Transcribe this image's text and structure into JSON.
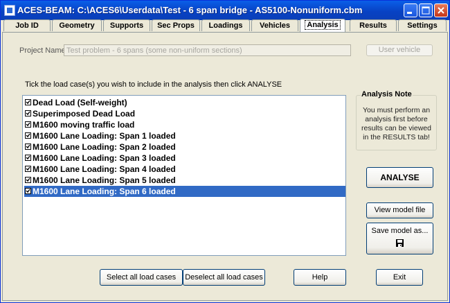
{
  "window": {
    "title": "ACES-BEAM:   C:\\ACES6\\Userdata\\Test - 6 span bridge - AS5100-Nonuniform.cbm",
    "controls": [
      "minimize-icon",
      "maximize-icon",
      "close-icon"
    ]
  },
  "tabs": [
    {
      "label": "Job ID",
      "active": false
    },
    {
      "label": "Geometry",
      "active": false
    },
    {
      "label": "Supports",
      "active": false
    },
    {
      "label": "Sec Props",
      "active": false
    },
    {
      "label": "Loadings",
      "active": false
    },
    {
      "label": "Vehicles",
      "active": false
    },
    {
      "label": "Analysis",
      "active": true
    },
    {
      "label": "Results",
      "active": false
    },
    {
      "label": "Settings",
      "active": false
    }
  ],
  "project": {
    "label": "Project Name:",
    "value": "Test problem - 6 spans (some non-uniform sections)",
    "user_vehicle_button": "User vehicle"
  },
  "instruction": "Tick the load case(s) you wish to include in the analysis then click ANALYSE",
  "load_cases": [
    {
      "label": "Dead Load (Self-weight)",
      "checked": true,
      "selected": false
    },
    {
      "label": "Superimposed Dead Load",
      "checked": true,
      "selected": false
    },
    {
      "label": "M1600 moving traffic load",
      "checked": true,
      "selected": false
    },
    {
      "label": "M1600 Lane Loading:  Span 1 loaded",
      "checked": true,
      "selected": false
    },
    {
      "label": "M1600 Lane Loading:  Span 2 loaded",
      "checked": true,
      "selected": false
    },
    {
      "label": "M1600 Lane Loading:  Span 3 loaded",
      "checked": true,
      "selected": false
    },
    {
      "label": "M1600 Lane Loading:  Span 4 loaded",
      "checked": true,
      "selected": false
    },
    {
      "label": "M1600 Lane Loading:  Span 5 loaded",
      "checked": true,
      "selected": false
    },
    {
      "label": "M1600 Lane Loading:  Span 6 loaded",
      "checked": true,
      "selected": true
    }
  ],
  "note": {
    "title": "Analysis Note",
    "text": "You must perform an analysis first before results can be viewed in the RESULTS tab!"
  },
  "buttons": {
    "analyse": "ANALYSE",
    "view_model": "View model file",
    "save_model": "Save model as...",
    "save_icon": "floppy-disk-icon",
    "select_all": "Select all load cases",
    "deselect_all": "Deselect all load cases",
    "help": "Help",
    "exit": "Exit"
  },
  "colors": {
    "titlebar": "#0842c4",
    "selection": "#316ac5",
    "close_button": "#c4361a"
  }
}
